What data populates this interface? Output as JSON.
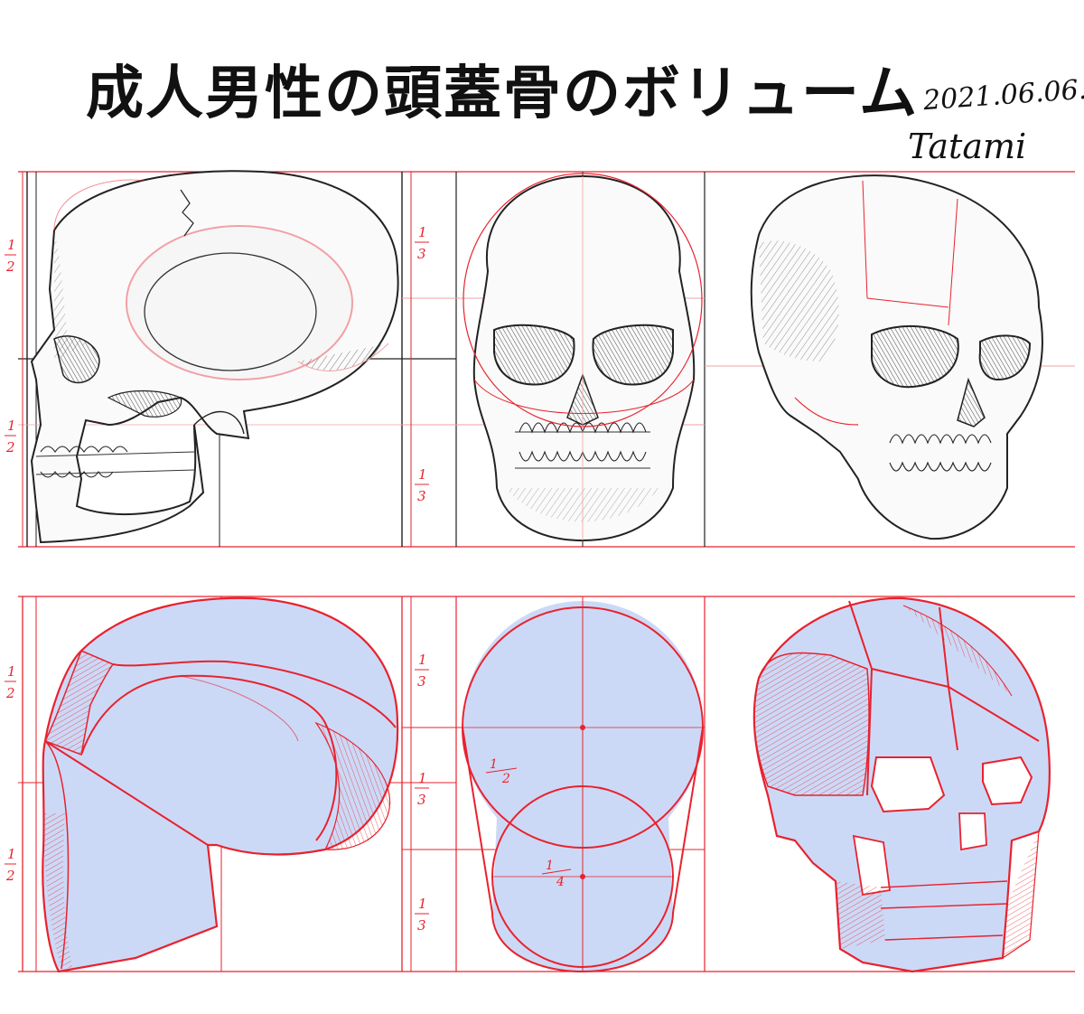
{
  "title": "成人男性の頭蓋骨のボリューム",
  "date": "2021.06.06.",
  "signature": "Tatami",
  "proportion_labels": {
    "one": "1",
    "two": "2",
    "three": "3",
    "four": "4",
    "half": "1/2"
  },
  "colors": {
    "guide_red": "#e8222e",
    "pale_red": "#f2a0a6",
    "volume_blue": "#ccd9f6",
    "pencil": "#222222"
  },
  "panels": {
    "top_row": [
      "skull-side-sketch",
      "skull-front-sketch",
      "skull-three-quarter-sketch"
    ],
    "bottom_row": [
      "side-volume-diagram",
      "front-volume-diagram",
      "three-quarter-volume-diagram"
    ]
  }
}
